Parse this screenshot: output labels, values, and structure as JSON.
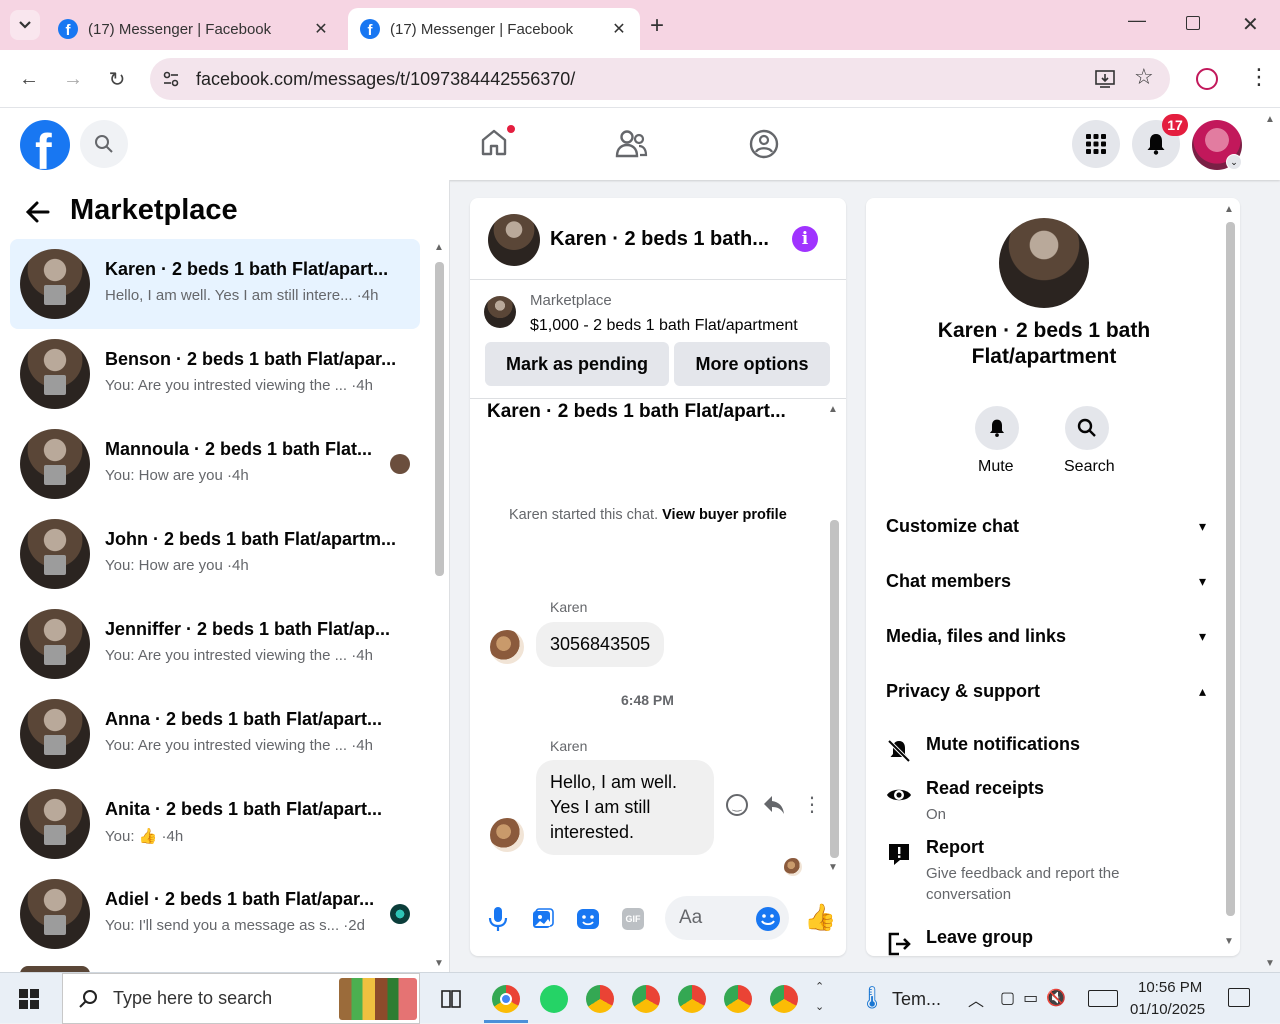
{
  "browser": {
    "tabs": [
      {
        "title": "(17) Messenger | Facebook",
        "active": false
      },
      {
        "title": "(17) Messenger | Facebook",
        "active": true
      }
    ],
    "url": "facebook.com/messages/t/1097384442556370/"
  },
  "header": {
    "notifications_count": "17"
  },
  "left": {
    "title": "Marketplace",
    "conversations": [
      {
        "name": "Karen · 2 beds 1 bath Flat/apart...",
        "snippet": "Hello, I am well. Yes I am still intere... ·4h",
        "selected": true
      },
      {
        "name": "Benson · 2 beds 1 bath Flat/apar...",
        "snippet": "You: Are you intrested viewing the ... ·4h"
      },
      {
        "name": "Mannoula · 2 beds 1 bath Flat...",
        "snippet": "You: How are you ·4h"
      },
      {
        "name": "John · 2 beds 1 bath Flat/apartm...",
        "snippet": "You: How are you ·4h"
      },
      {
        "name": "Jenniffer · 2 beds 1 bath Flat/ap...",
        "snippet": "You: Are you intrested viewing the ... ·4h"
      },
      {
        "name": "Anna · 2 beds 1 bath Flat/apart...",
        "snippet": "You: Are you intrested viewing the ... ·4h"
      },
      {
        "name": "Anita · 2 beds 1 bath Flat/apart...",
        "snippet_prefix": "You: ",
        "snippet_suffix": " ·4h"
      },
      {
        "name": "Adiel · 2 beds 1 bath Flat/apar...",
        "snippet": "You: I'll send you a message as s... ·2d"
      }
    ]
  },
  "chat": {
    "header_title": "Karen · 2 beds 1 bath...",
    "listing_label": "Marketplace",
    "listing_detail": "$1,000 - 2 beds 1 bath Flat/apartment",
    "mark_pending": "Mark as pending",
    "more_options": "More options",
    "thread_title": "Karen · 2 beds 1 bath Flat/apart...",
    "started_text": "Karen started this chat.",
    "view_profile": "View buyer profile",
    "msg1_sender": "Karen",
    "msg1_text": "3056843505",
    "time_sep": "6:48 PM",
    "msg2_sender": "Karen",
    "msg2_text": "Hello, I am well. Yes I am still interested.",
    "composer_placeholder": "Aa"
  },
  "info": {
    "title": "Karen · 2 beds 1 bath Flat/apartment",
    "mute_label": "Mute",
    "search_label": "Search",
    "sections": [
      "Customize chat",
      "Chat members",
      "Media, files and links",
      "Privacy & support"
    ],
    "items": [
      {
        "title": "Mute notifications",
        "sub": ""
      },
      {
        "title": "Read receipts",
        "sub": "On"
      },
      {
        "title": "Report",
        "sub": "Give feedback and report the conversation"
      },
      {
        "title": "Leave group",
        "sub": ""
      }
    ]
  },
  "taskbar": {
    "search_placeholder": "Type here to search",
    "weather": "Tem...",
    "time": "10:56 PM",
    "date": "01/10/2025"
  },
  "colors": {
    "fb_blue": "#1877f2",
    "messenger_purple": "#a033ff",
    "notif_red": "#e41e3f",
    "tabbar_pink": "#f6d5e3"
  }
}
